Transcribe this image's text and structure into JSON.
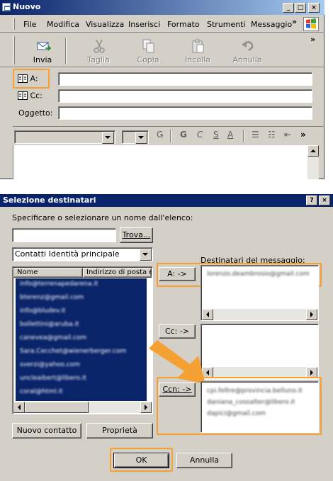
{
  "compose_window": {
    "title": "Nuovo",
    "menu": [
      "File",
      "Modifica",
      "Visualizza",
      "Inserisci",
      "Formato",
      "Strumenti",
      "Messaggio"
    ],
    "menu_overflow": "»",
    "toolbar": [
      {
        "label": "Invia",
        "icon": "send-icon",
        "enabled": true
      },
      {
        "label": "Taglia",
        "icon": "scissors-icon",
        "enabled": false
      },
      {
        "label": "Copia",
        "icon": "copy-icon",
        "enabled": false
      },
      {
        "label": "Incolla",
        "icon": "paste-icon",
        "enabled": false
      },
      {
        "label": "Annulla",
        "icon": "undo-icon",
        "enabled": false
      }
    ],
    "toolbar_overflow": "»",
    "fields": {
      "to_label": "A:",
      "cc_label": "Cc:",
      "subject_label": "Oggetto:"
    },
    "format_glyphs": [
      "Ǥ",
      "G",
      "C",
      "S",
      "A",
      "☰",
      "☷",
      "⇤",
      "»"
    ]
  },
  "dialog": {
    "title": "Selezione destinatari",
    "help_btn": "?",
    "close_btn": "×",
    "instruction": "Specificare o selezionare un nome dall'elenco:",
    "search_value": "",
    "find_button": "Trova...",
    "address_book": "Contatti Identità principale",
    "columns": [
      "Nome",
      "Indirizzo di posta el"
    ],
    "contacts": [
      "info@terrenapedarena.it",
      "bterenz@gmail.com",
      "info@bludev.it",
      "bollettini@aruba.it",
      "canevea@gmail.com",
      "Sara.Cecchet@wienerberger.com",
      "sverzi@yahoo.com",
      "uncleaibert@libero.it",
      "coral@html.it"
    ],
    "recipients_label": "Destinatari del messaggio:",
    "to_button": "A: ->",
    "cc_button": "Cc: ->",
    "bcc_button": "Ccn: ->",
    "to_recipients": [
      "lorenzo.deambrosio@gmail.com"
    ],
    "cc_recipients": [],
    "bcc_recipients": [
      "cpi.feltre@provincia.belluno.it",
      "daniana_cossalter@libero.it",
      "dapici@gmail.com"
    ],
    "new_contact_button": "Nuovo contatto",
    "properties_button": "Proprietà",
    "ok_button": "OK",
    "cancel_button": "Annulla"
  },
  "colors": {
    "highlight": "#f5a032",
    "titlebar": "#0a246a",
    "selection": "#0a246a"
  }
}
